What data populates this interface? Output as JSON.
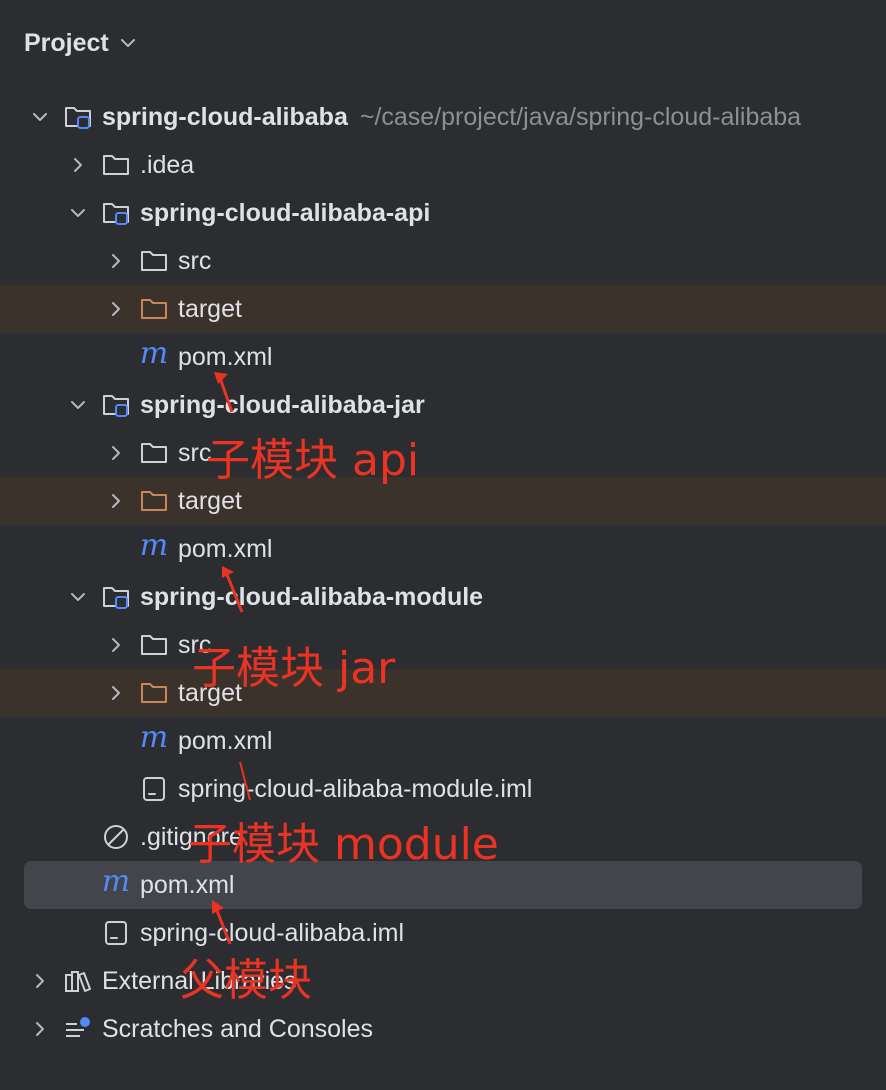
{
  "header": {
    "title": "Project"
  },
  "tree": {
    "root": {
      "label": "spring-cloud-alibaba",
      "path": "~/case/project/java/spring-cloud-alibaba"
    },
    "idea": {
      "label": ".idea"
    },
    "api": {
      "label": "spring-cloud-alibaba-api",
      "src": "src",
      "target": "target",
      "pom": "pom.xml"
    },
    "jar": {
      "label": "spring-cloud-alibaba-jar",
      "src": "src",
      "target": "target",
      "pom": "pom.xml"
    },
    "module": {
      "label": "spring-cloud-alibaba-module",
      "src": "src",
      "target": "target",
      "pom": "pom.xml",
      "iml": "spring-cloud-alibaba-module.iml"
    },
    "gitignore": ".gitignore",
    "pom": "pom.xml",
    "iml": "spring-cloud-alibaba.iml",
    "external": "External Libraries",
    "scratches": "Scratches and Consoles"
  },
  "annotations": {
    "api": "子模块 api",
    "jar": "子模块 jar",
    "module": "子模块 module",
    "parent": "父模块"
  },
  "colors": {
    "background": "#2b2d30",
    "excluded_row": "#3a322b",
    "selected_row": "#43454a",
    "maven_blue": "#548af7",
    "annotation_red": "#ea3323",
    "excluded_folder": "#c7875b"
  }
}
